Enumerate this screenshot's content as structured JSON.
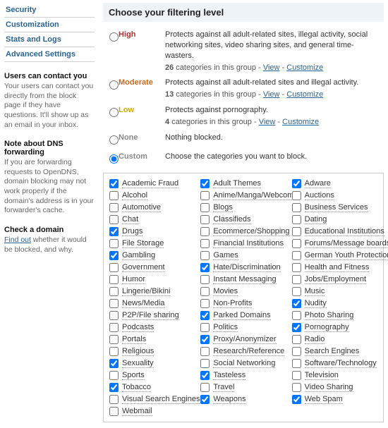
{
  "sidebar": {
    "nav": [
      "Security",
      "Customization",
      "Stats and Logs",
      "Advanced Settings"
    ],
    "blocks": [
      {
        "title": "Users can contact you",
        "text": "Your users can contact you directly from the block page if they have questions. It'll show up as an email in your inbox."
      },
      {
        "title": "Note about DNS forwarding",
        "text": "If you are forwarding requests to OpenDNS, domain blocking may not work properly if the domain's address is in your forwarder's cache."
      },
      {
        "title": "Check a domain",
        "link": "Find out",
        "text": " whether it would be blocked, and why."
      }
    ]
  },
  "heading": "Choose your filtering level",
  "levels": [
    {
      "key": "high",
      "name": "High",
      "cls": "lv-high",
      "checked": false,
      "desc": "Protects against all adult-related sites, illegal activity, social networking sites, video sharing sites, and general time-wasters.",
      "sub_count": "26 categories in this group",
      "view": "View",
      "cust": "Customize"
    },
    {
      "key": "moderate",
      "name": "Moderate",
      "cls": "lv-mod",
      "checked": false,
      "desc": "Protects against all adult-related sites and illegal activity.",
      "sub_count": "13 categories in this group",
      "view": "View",
      "cust": "Customize"
    },
    {
      "key": "low",
      "name": "Low",
      "cls": "lv-low",
      "checked": false,
      "desc": "Protects against pornography.",
      "sub_count": "4 categories in this group",
      "view": "View",
      "cust": "Customize"
    },
    {
      "key": "none",
      "name": "None",
      "cls": "lv-none",
      "checked": false,
      "desc": "Nothing blocked."
    },
    {
      "key": "custom",
      "name": "Custom",
      "cls": "lv-custom",
      "checked": true,
      "desc": "Choose the categories you want to block."
    }
  ],
  "categories": [
    {
      "label": "Academic Fraud",
      "checked": true
    },
    {
      "label": "Adult Themes",
      "checked": true
    },
    {
      "label": "Adware",
      "checked": true
    },
    {
      "label": "Alcohol",
      "checked": false
    },
    {
      "label": "Anime/Manga/Webcomic",
      "checked": false
    },
    {
      "label": "Auctions",
      "checked": false
    },
    {
      "label": "Automotive",
      "checked": false
    },
    {
      "label": "Blogs",
      "checked": false
    },
    {
      "label": "Business Services",
      "checked": false
    },
    {
      "label": "Chat",
      "checked": false
    },
    {
      "label": "Classifieds",
      "checked": false
    },
    {
      "label": "Dating",
      "checked": false
    },
    {
      "label": "Drugs",
      "checked": true
    },
    {
      "label": "Ecommerce/Shopping",
      "checked": false
    },
    {
      "label": "Educational Institutions",
      "checked": false
    },
    {
      "label": "File Storage",
      "checked": false
    },
    {
      "label": "Financial Institutions",
      "checked": false
    },
    {
      "label": "Forums/Message boards",
      "checked": false
    },
    {
      "label": "Gambling",
      "checked": true
    },
    {
      "label": "Games",
      "checked": false
    },
    {
      "label": "German Youth Protection",
      "checked": false
    },
    {
      "label": "Government",
      "checked": false
    },
    {
      "label": "Hate/Discrimination",
      "checked": true
    },
    {
      "label": "Health and Fitness",
      "checked": false
    },
    {
      "label": "Humor",
      "checked": false
    },
    {
      "label": "Instant Messaging",
      "checked": false
    },
    {
      "label": "Jobs/Employment",
      "checked": false
    },
    {
      "label": "Lingerie/Bikini",
      "checked": false
    },
    {
      "label": "Movies",
      "checked": false
    },
    {
      "label": "Music",
      "checked": false
    },
    {
      "label": "News/Media",
      "checked": false
    },
    {
      "label": "Non-Profits",
      "checked": false
    },
    {
      "label": "Nudity",
      "checked": true
    },
    {
      "label": "P2P/File sharing",
      "checked": false
    },
    {
      "label": "Parked Domains",
      "checked": true
    },
    {
      "label": "Photo Sharing",
      "checked": false
    },
    {
      "label": "Podcasts",
      "checked": false
    },
    {
      "label": "Politics",
      "checked": false
    },
    {
      "label": "Pornography",
      "checked": true
    },
    {
      "label": "Portals",
      "checked": false
    },
    {
      "label": "Proxy/Anonymizer",
      "checked": true
    },
    {
      "label": "Radio",
      "checked": false
    },
    {
      "label": "Religious",
      "checked": false
    },
    {
      "label": "Research/Reference",
      "checked": false
    },
    {
      "label": "Search Engines",
      "checked": false
    },
    {
      "label": "Sexuality",
      "checked": true
    },
    {
      "label": "Social Networking",
      "checked": false
    },
    {
      "label": "Software/Technology",
      "checked": false
    },
    {
      "label": "Sports",
      "checked": false
    },
    {
      "label": "Tasteless",
      "checked": true
    },
    {
      "label": "Television",
      "checked": false
    },
    {
      "label": "Tobacco",
      "checked": true
    },
    {
      "label": "Travel",
      "checked": false
    },
    {
      "label": "Video Sharing",
      "checked": false
    },
    {
      "label": "Visual Search Engines",
      "checked": false
    },
    {
      "label": "Weapons",
      "checked": true
    },
    {
      "label": "Web Spam",
      "checked": true
    },
    {
      "label": "Webmail",
      "checked": false
    }
  ]
}
